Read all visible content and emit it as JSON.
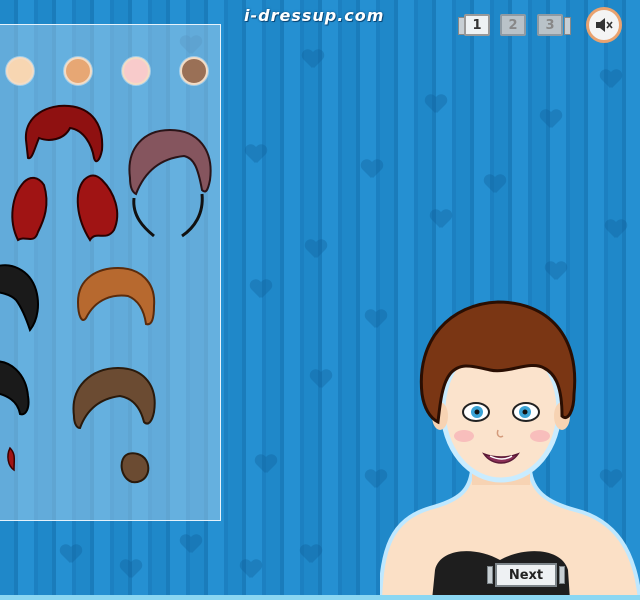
{
  "header": {
    "logo_text": "i-dressup.com",
    "pages": [
      "1",
      "2",
      "3"
    ],
    "active_page": "1"
  },
  "sound": {
    "icon": "speaker-mute-icon"
  },
  "skin_tones": [
    "#f7d6b2",
    "#e7a774",
    "#f8cbcb",
    "#9a7056"
  ],
  "hair_options": [
    {
      "name": "hair-dark-red-long",
      "color": "#9e1313"
    },
    {
      "name": "hair-mauve-bob",
      "color": "#84545c"
    },
    {
      "name": "hair-black-side",
      "color": "#1a1a1a"
    },
    {
      "name": "hair-orange-curly",
      "color": "#b86a30"
    },
    {
      "name": "hair-black-short",
      "color": "#1a1a1a"
    },
    {
      "name": "hair-brown-bun",
      "color": "#6b4b32"
    }
  ],
  "next_button": {
    "label": "Next"
  },
  "colors": {
    "background": "#1f88c9",
    "panel_border": "#e6f2fb",
    "sound_ring": "#e9a26f"
  }
}
